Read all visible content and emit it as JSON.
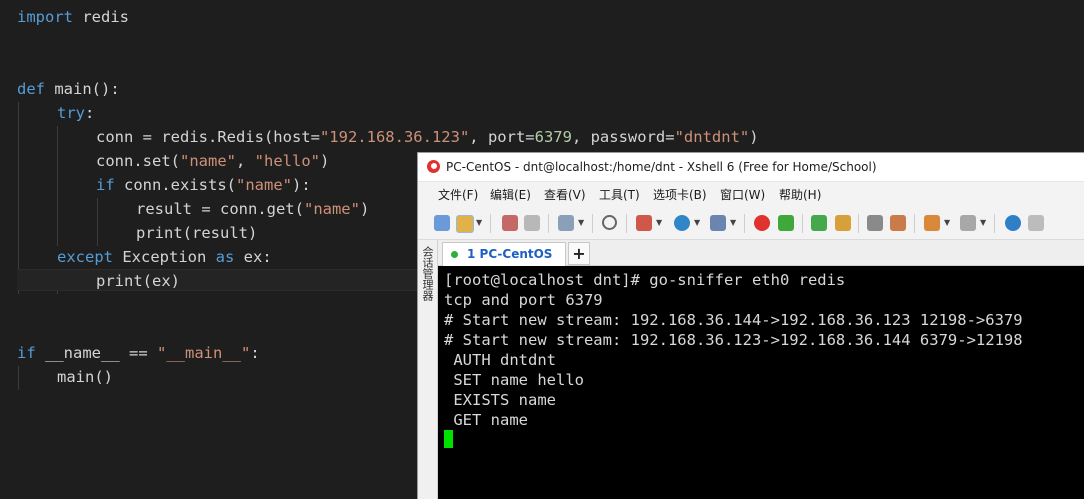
{
  "editor": {
    "lines": {
      "l1": [
        "import",
        " redis"
      ],
      "l4": [
        "def",
        " main():"
      ],
      "l5": [
        "try",
        ":"
      ],
      "l6": [
        "conn = redis.Redis(host=",
        "\"192.168.36.123\"",
        ", port=",
        "6379",
        ", password=",
        "\"dntdnt\"",
        ")"
      ],
      "l7": [
        "conn.set(",
        "\"name\"",
        ", ",
        "\"hello\"",
        ")"
      ],
      "l8": [
        "if",
        " conn.exists(",
        "\"name\"",
        "):"
      ],
      "l9": [
        "result = conn.get(",
        "\"name\"",
        ")"
      ],
      "l10": [
        "print(result)"
      ],
      "l11": [
        "except",
        " Exception ",
        "as",
        " ex:"
      ],
      "l12": [
        "print(ex)"
      ],
      "l15": [
        "if",
        " __name__ == ",
        "\"__main__\"",
        ":"
      ],
      "l16": [
        "main()"
      ]
    }
  },
  "xshell": {
    "title": "PC-CentOS - dnt@localhost:/home/dnt - Xshell 6 (Free for Home/School)",
    "menu": [
      "文件(F)",
      "编辑(E)",
      "查看(V)",
      "工具(T)",
      "选项卡(B)",
      "窗口(W)",
      "帮助(H)"
    ],
    "sidebar_label": "会话管理器",
    "tab_label": "1 PC-CentOS",
    "tab_add": "+",
    "terminal_lines": [
      "[root@localhost dnt]# go-sniffer eth0 redis",
      "tcp and port 6379",
      "# Start new stream: 192.168.36.144->192.168.36.123 12198->6379",
      "# Start new stream: 192.168.36.123->192.168.36.144 6379->12198",
      " AUTH dntdnt",
      " SET name hello",
      " EXISTS name",
      " GET name"
    ]
  },
  "colors": {
    "editor_bg": "#1e1e1e",
    "keyword": "#569cd6",
    "string": "#ce9178",
    "number": "#b5cea8",
    "cursor": "#00e100"
  }
}
